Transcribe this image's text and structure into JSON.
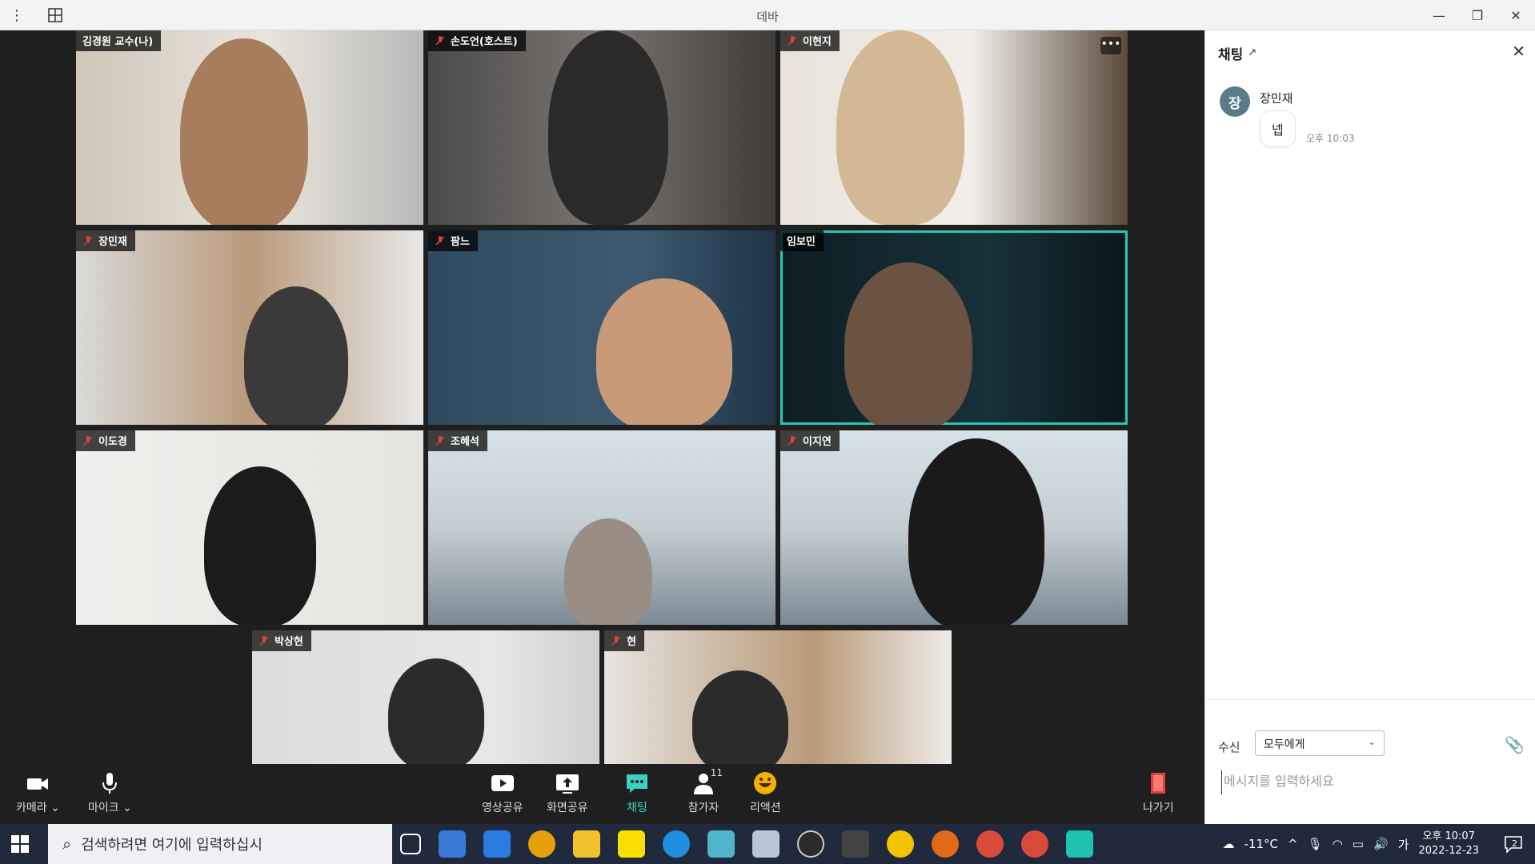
{
  "window": {
    "title": "데바"
  },
  "participants": [
    {
      "name": "김경원 교수(나)",
      "muted": false
    },
    {
      "name": "손도언(호스트)",
      "muted": true
    },
    {
      "name": "이현지",
      "muted": true
    },
    {
      "name": "장민재",
      "muted": true
    },
    {
      "name": "팜느",
      "muted": true
    },
    {
      "name": "임보민",
      "muted": false,
      "active": true
    },
    {
      "name": "이도경",
      "muted": true
    },
    {
      "name": "조혜석",
      "muted": true
    },
    {
      "name": "이지연",
      "muted": true
    },
    {
      "name": "박상현",
      "muted": true
    },
    {
      "name": "현",
      "muted": true
    }
  ],
  "toolbar": {
    "camera": "카메라",
    "mic": "마이크",
    "share_video": "영상공유",
    "share_screen": "화면공유",
    "chat": "채팅",
    "participants": "참가자",
    "participants_count": "11",
    "reaction": "리액션",
    "leave": "나가기"
  },
  "chat": {
    "title": "채팅",
    "messages": [
      {
        "avatar": "장",
        "sender": "장민재",
        "text": "넵",
        "time": "오후 10:03"
      }
    ],
    "recipient_label": "수신",
    "recipient_value": "모두에게",
    "input_placeholder": "메시지를 입력하세요"
  },
  "taskbar": {
    "search_placeholder": "검색하려면 여기에 입력하십시",
    "weather": "-11°C",
    "ime": "가",
    "time": "오후 10:07",
    "date": "2022-12-23",
    "notifications": "2"
  },
  "colors": {
    "accent": "#24c7b6",
    "chat_active": "#3ad2c2",
    "leave": "#e0403d"
  }
}
